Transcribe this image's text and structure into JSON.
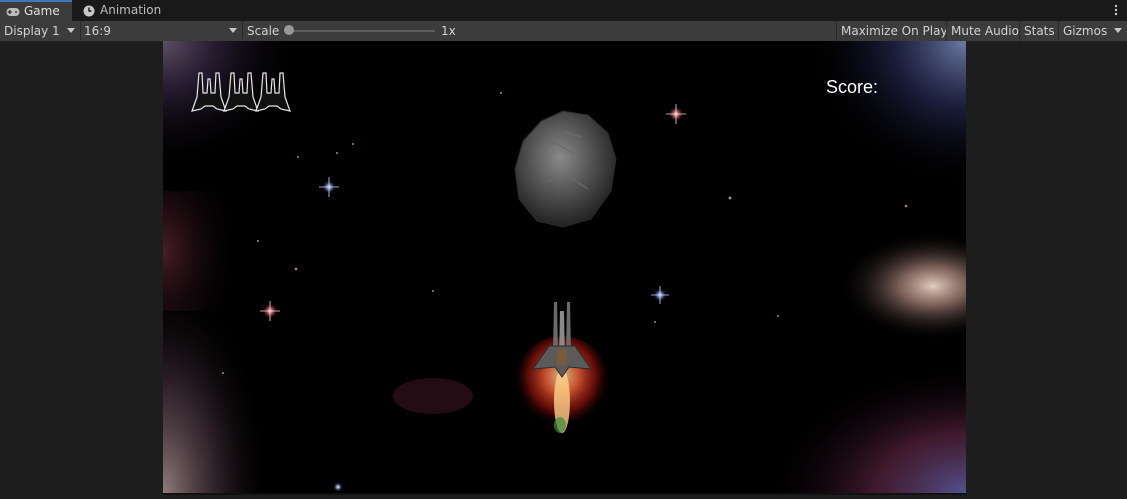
{
  "tabs": [
    {
      "label": "Game",
      "icon": "gamepad-icon",
      "active": true
    },
    {
      "label": "Animation",
      "icon": "clock-icon",
      "active": false
    }
  ],
  "toolbar": {
    "display": "Display 1",
    "aspect": "16:9",
    "scale_label": "Scale",
    "scale_value": "1x",
    "scale_level": 0.0,
    "maximize_on_play": "Maximize On Play",
    "mute_audio": "Mute Audio",
    "stats": "Stats",
    "gizmos": "Gizmos"
  },
  "game": {
    "score_label": "Score:",
    "lives": 3
  },
  "colors": {
    "tab_accent": "#3a79bb",
    "panel_bg": "#3c3c3c",
    "toolbar_text": "#d2d2d2",
    "game_bg": "#000000",
    "score_text": "#ffffff"
  }
}
